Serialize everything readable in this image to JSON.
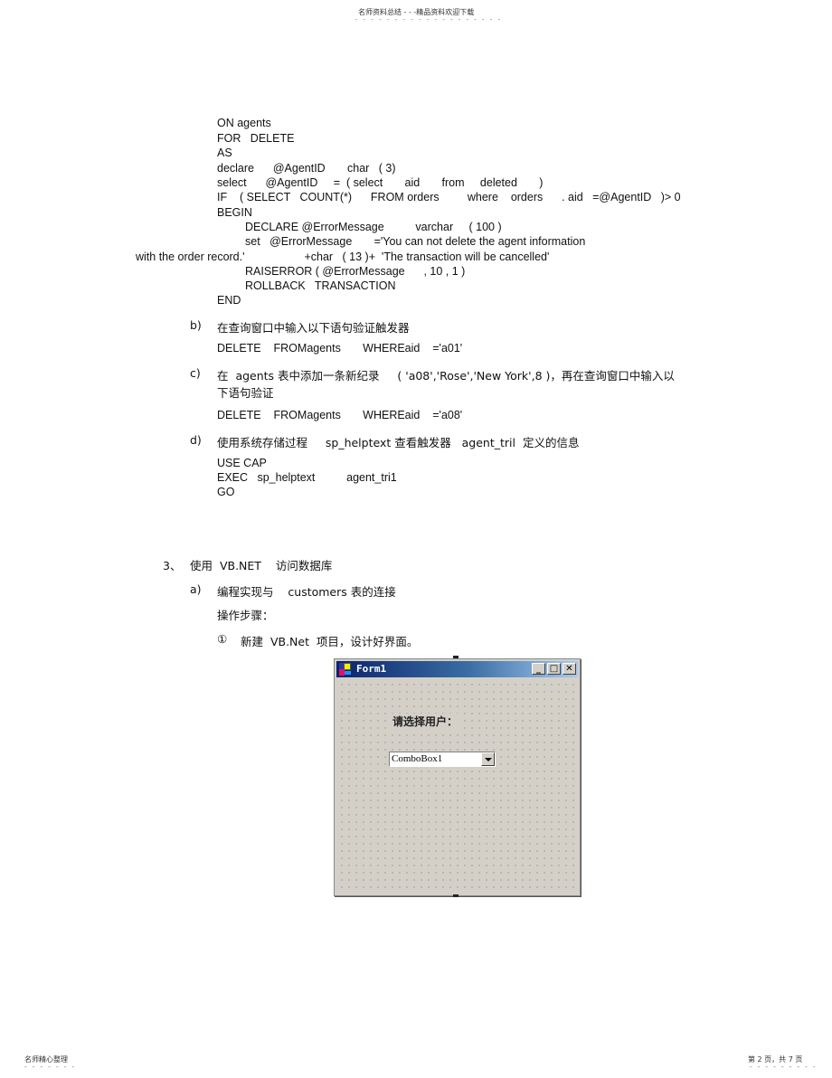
{
  "page_header": {
    "text": "名师资料总结 - - -精品资料欢迎下载",
    "dots": "- - - - - - - - - - - - - - - - - - -"
  },
  "code_block_1": [
    "ON agents",
    "FOR   DELETE",
    "AS",
    "declare      @AgentID       char   ( 3)",
    "select      @AgentID     =  ( select       aid       from     deleted       )",
    "IF    ( SELECT   COUNT(*)      FROM orders         where    orders      . aid   =@AgentID   )> 0",
    "BEGIN",
    "DECLARE @ErrorMessage          varchar     ( 100 )",
    "set   @ErrorMessage       ='You can not delete the agent information",
    "with the order record.'                   +char   ( 13 )+  'The transaction will be cancelled'",
    "RAISERROR ( @ErrorMessage      , 10 , 1 )",
    "ROLLBACK   TRANSACTION",
    "END"
  ],
  "items": {
    "b": {
      "marker": "b)",
      "text": "在查询窗口中输入以下语句验证触发器",
      "code": "DELETE    FROMagents       WHEREaid    ='a01'"
    },
    "c": {
      "marker": "c)",
      "text_line1": "在  agents 表中添加一条新纪录     ( 'a08','Rose','New York',8 )，再在查询窗口中输入以",
      "text_line2": "下语句验证",
      "code": "DELETE    FROMagents       WHEREaid    ='a08'"
    },
    "d": {
      "marker": "d)",
      "text": "使用系统存储过程     sp_helptext 查看触发器   agent_tril  定义的信息",
      "code": [
        "USE CAP",
        "EXEC   sp_helptext          agent_tri1",
        "GO"
      ]
    }
  },
  "section3": {
    "marker": "3、",
    "title": "使用  VB.NET    访问数据库",
    "a": {
      "marker": "a)",
      "text": "编程实现与    customers 表的连接",
      "steps_label": "操作步骤：",
      "step1_marker": "①",
      "step1_text": "新建  VB.Net  项目，设计好界面。"
    }
  },
  "vb_form": {
    "title": "Form1",
    "minimize": "_",
    "maximize": "□",
    "close": "✕",
    "label": "请选择用户：",
    "combobox_value": "ComboBox1"
  },
  "page_footer": {
    "left": "名师精心整理",
    "left_dots": "- - - - - - -",
    "right": "第 2 页，共 7 页",
    "right_dots": "- - - - - - - - -"
  }
}
